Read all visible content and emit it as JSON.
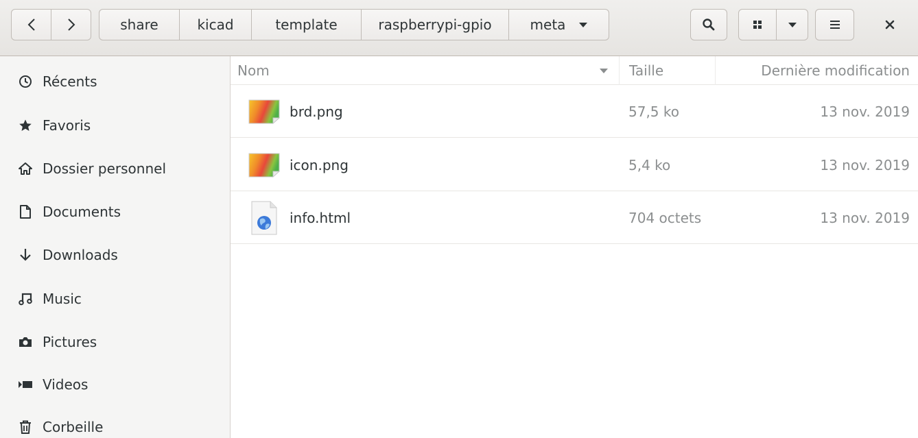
{
  "breadcrumbs": [
    {
      "label": "share"
    },
    {
      "label": "kicad"
    },
    {
      "label": "template"
    },
    {
      "label": "raspberrypi-gpio"
    },
    {
      "label": "meta"
    }
  ],
  "icons": {
    "back": "chevron-left-icon",
    "forward": "chevron-right-icon",
    "search": "search-icon",
    "view": "grid-view-icon",
    "menu": "hamburger-menu-icon",
    "close": "close-icon"
  },
  "sidebar": {
    "items": [
      {
        "label": "Récents",
        "icon": "clock-icon"
      },
      {
        "label": "Favoris",
        "icon": "star-icon"
      },
      {
        "label": "Dossier personnel",
        "icon": "home-icon"
      },
      {
        "label": "Documents",
        "icon": "document-icon"
      },
      {
        "label": "Downloads",
        "icon": "download-icon"
      },
      {
        "label": "Music",
        "icon": "music-icon"
      },
      {
        "label": "Pictures",
        "icon": "camera-icon"
      },
      {
        "label": "Videos",
        "icon": "video-icon"
      },
      {
        "label": "Corbeille",
        "icon": "trash-icon"
      }
    ]
  },
  "columns": {
    "name": "Nom",
    "size": "Taille",
    "modified": "Dernière modification"
  },
  "files": [
    {
      "name": "brd.png",
      "size": "57,5 ko",
      "modified": "13 nov. 2019",
      "icon": "image-file-icon"
    },
    {
      "name": "icon.png",
      "size": "5,4 ko",
      "modified": "13 nov. 2019",
      "icon": "image-file-icon"
    },
    {
      "name": "info.html",
      "size": "704 octets",
      "modified": "13 nov. 2019",
      "icon": "html-file-icon"
    }
  ]
}
